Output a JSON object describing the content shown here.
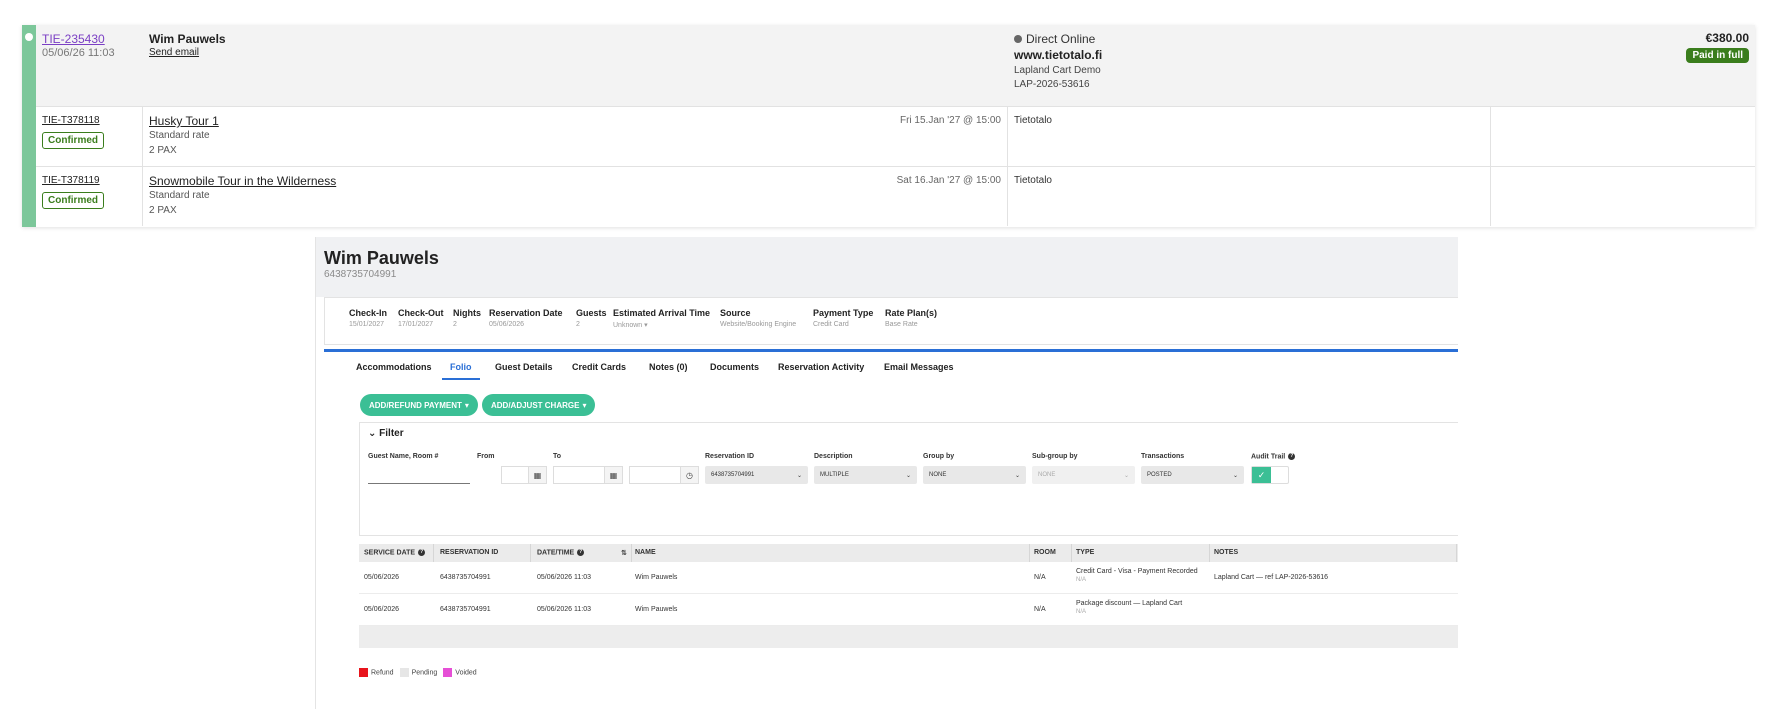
{
  "booking": {
    "reservation_number": "TIE-235430",
    "created": "05/06/26 11:03",
    "guest_name": "Wim Pauwels",
    "send_email": "Send email",
    "channel": "Direct Online",
    "website": "www.tietotalo.fi",
    "cart_name": "Lapland Cart Demo",
    "cart_ref": "LAP-2026-53616",
    "total": "€380.00",
    "payment_status": "Paid in full",
    "items": [
      {
        "id": "TIE-T378118",
        "status": "Confirmed",
        "name": "Husky Tour 1",
        "rate": "Standard rate",
        "pax": "2 PAX",
        "when": "Fri 15.Jan '27 @ 15:00",
        "location": "Tietotalo"
      },
      {
        "id": "TIE-T378119",
        "status": "Confirmed",
        "name": "Snowmobile Tour in the Wilderness",
        "rate": "Standard rate",
        "pax": "2 PAX",
        "when": "Sat 16.Jan '27 @ 15:00",
        "location": "Tietotalo"
      }
    ]
  },
  "reservation": {
    "guest_name": "Wim Pauwels",
    "reservation_id": "6438735704991",
    "summary": [
      {
        "label": "Check-In",
        "value": "15/01/2027"
      },
      {
        "label": "Check-Out",
        "value": "17/01/2027"
      },
      {
        "label": "Nights",
        "value": "2"
      },
      {
        "label": "Reservation Date",
        "value": "05/06/2026"
      },
      {
        "label": "Guests",
        "value": "2"
      },
      {
        "label": "Estimated Arrival Time",
        "value": "Unknown"
      },
      {
        "label": "Source",
        "value": "Website/Booking Engine"
      },
      {
        "label": "Payment Type",
        "value": "Credit Card"
      },
      {
        "label": "Rate Plan(s)",
        "value": "Base Rate"
      }
    ],
    "tabs": [
      "Accommodations",
      "Folio",
      "Guest Details",
      "Credit Cards",
      "Notes (0)",
      "Documents",
      "Reservation Activity",
      "Email Messages"
    ],
    "active_tab": "Folio",
    "actions": {
      "payment": "ADD/REFUND PAYMENT",
      "charge": "ADD/ADJUST CHARGE"
    },
    "filter": {
      "title": "Filter",
      "labels": {
        "guest": "Guest Name, Room #",
        "from": "From",
        "to": "To",
        "reservation_id": "Reservation ID",
        "description": "Description",
        "group_by": "Group by",
        "sub_group_by": "Sub-group by",
        "transactions": "Transactions",
        "audit_trail": "Audit Trail"
      },
      "values": {
        "reservation_id": "6438735704991",
        "description": "MULTIPLE",
        "group_by": "NONE",
        "sub_group_by": "NONE",
        "transactions": "POSTED"
      }
    },
    "table": {
      "headers": {
        "service_date": "SERVICE DATE",
        "reservation_id": "RESERVATION ID",
        "datetime": "DATE/TIME",
        "name": "NAME",
        "room": "ROOM",
        "type": "TYPE",
        "notes": "NOTES"
      },
      "rows": [
        {
          "service_date": "05/06/2026",
          "reservation_id": "6438735704991",
          "datetime": "05/06/2026 11:03",
          "name": "Wim Pauwels",
          "room": "N/A",
          "type": "Credit Card - Visa - Payment Recorded",
          "type_sub": "N/A",
          "notes": "Lapland Cart — ref LAP-2026-53616"
        },
        {
          "service_date": "05/06/2026",
          "reservation_id": "6438735704991",
          "datetime": "05/06/2026 11:03",
          "name": "Wim Pauwels",
          "room": "N/A",
          "type": "Package discount — Lapland Cart",
          "type_sub": "N/A",
          "notes": ""
        }
      ]
    },
    "legend": [
      "Refund",
      "Pending",
      "Voided"
    ],
    "legend_colors": [
      "#e8141c",
      "#e6e6e6",
      "#e64fd6"
    ]
  },
  "colors": {
    "stripe": "#7cc79a",
    "link": "#7b3fc4",
    "paid": "#3a7d1c",
    "accent": "#2a6fd6",
    "action": "#3bbf95"
  }
}
